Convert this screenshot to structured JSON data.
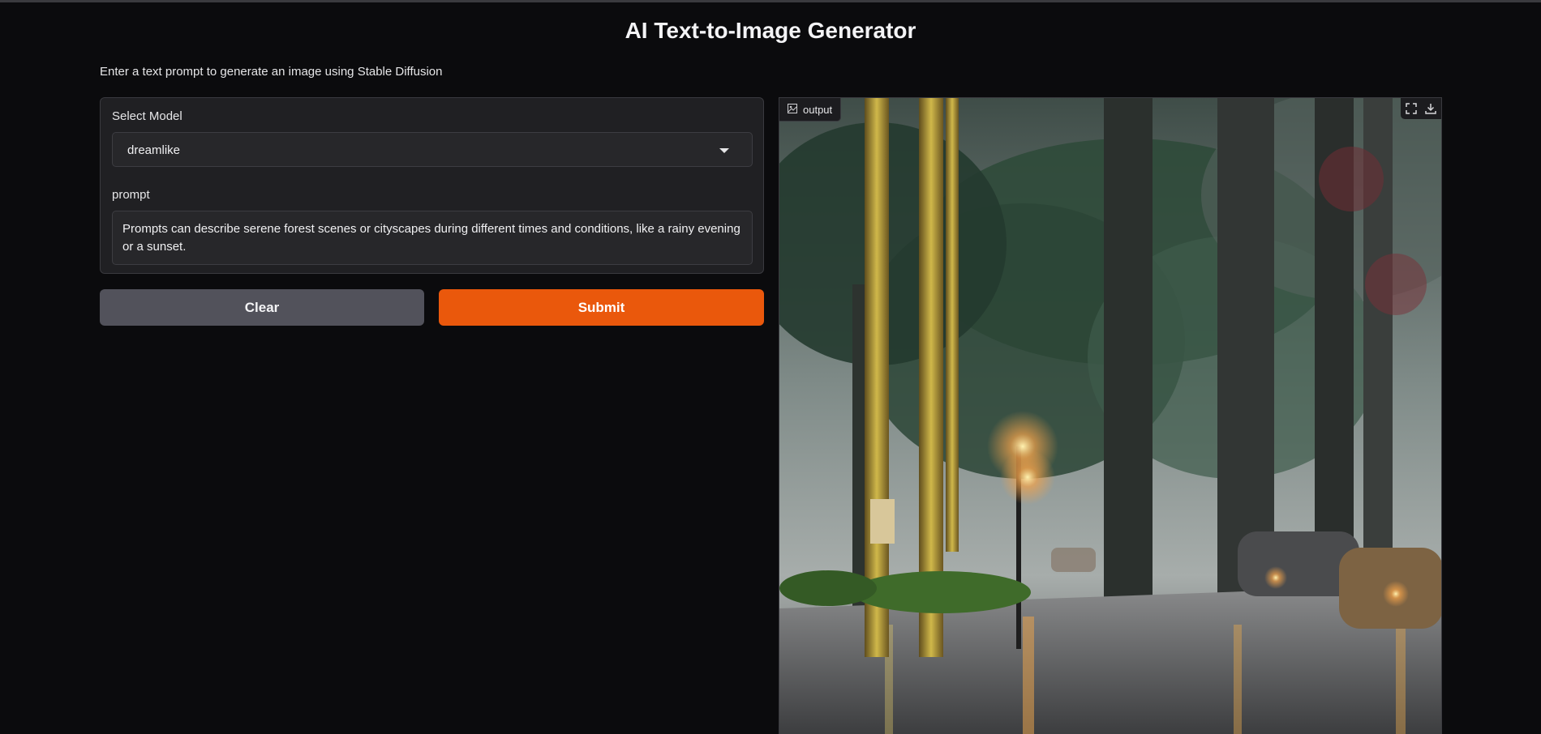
{
  "app": {
    "title": "AI Text-to-Image Generator",
    "description": "Enter a text prompt to generate an image using Stable Diffusion"
  },
  "model_select": {
    "label": "Select Model",
    "value": "dreamlike"
  },
  "prompt": {
    "label": "prompt",
    "value": "Prompts can describe serene forest scenes or cityscapes during different times and conditions, like a rainy evening or a sunset."
  },
  "buttons": {
    "clear_label": "Clear",
    "submit_label": "Submit"
  },
  "output": {
    "label": "output",
    "icons": [
      "image-icon",
      "fullscreen-icon",
      "download-icon"
    ]
  },
  "colors": {
    "background": "#0b0b0d",
    "panel": "#202023",
    "accent": "#ea580c",
    "secondary_button": "#52525b"
  }
}
